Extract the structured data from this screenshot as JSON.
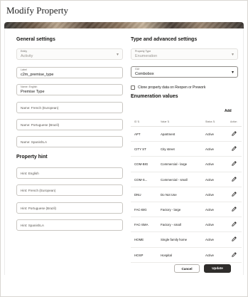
{
  "dialog": {
    "title": "Modify Property"
  },
  "general": {
    "heading": "General settings",
    "entity": {
      "label": "Entity",
      "value": "Activity"
    },
    "label": {
      "label": "Label",
      "value": "c2m_premise_type"
    },
    "name_english": {
      "label": "Name: English",
      "value": "Premise Type"
    },
    "name_french": {
      "placeholder": "Name: French (European)"
    },
    "name_portuguese": {
      "placeholder": "Name: Portuguese (Brazil)"
    },
    "name_spanish": {
      "placeholder": "Name: SpanishLA"
    }
  },
  "hint": {
    "heading": "Property hint",
    "english": {
      "placeholder": "Hint: English"
    },
    "french": {
      "placeholder": "Hint: French (European)"
    },
    "portuguese": {
      "placeholder": "Hint: Portuguese (Brazil)"
    },
    "spanish": {
      "placeholder": "Hint: SpanishLA"
    }
  },
  "advanced": {
    "heading": "Type and advanced settings",
    "property_type": {
      "label": "Property Type",
      "value": "Enumeration"
    },
    "gui": {
      "label": "GUI",
      "value": "Combobox"
    },
    "clone_label": "Clone property data on Reopen or Prework"
  },
  "enumeration": {
    "heading": "Enumeration values",
    "add_label": "Add",
    "columns": {
      "id": "ID",
      "value": "Value",
      "status": "Status",
      "action": "Action"
    },
    "rows": [
      {
        "id": "APT",
        "value": "Apartment",
        "status": "Active"
      },
      {
        "id": "CITY ST",
        "value": "City street",
        "status": "Active"
      },
      {
        "id": "COM-BIG",
        "value": "Commercial - large",
        "status": "Active"
      },
      {
        "id": "COM-S...",
        "value": "Commercial - small",
        "status": "Active"
      },
      {
        "id": "DNU",
        "value": "Do Not Use",
        "status": "Active"
      },
      {
        "id": "FAC-BIG",
        "value": "Factory - large",
        "status": "Active"
      },
      {
        "id": "FAC-SMA",
        "value": "Factory - small",
        "status": "Active"
      },
      {
        "id": "HOME",
        "value": "Single family home",
        "status": "Active"
      },
      {
        "id": "HOSP",
        "value": "Hospital",
        "status": "Active"
      }
    ]
  },
  "footer": {
    "cancel_label": "Cancel",
    "update_label": "Update"
  }
}
